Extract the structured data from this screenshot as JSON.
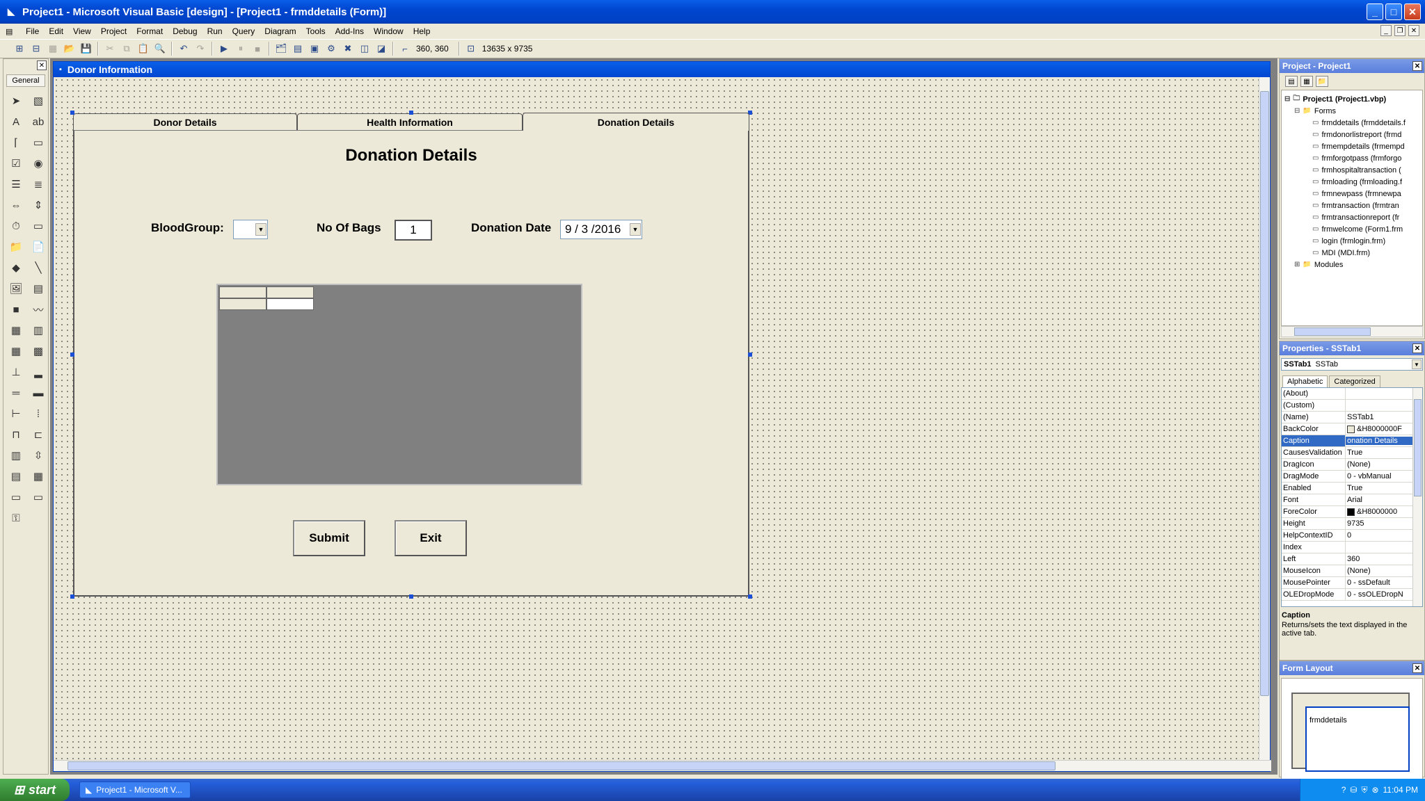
{
  "window": {
    "title": "Project1 - Microsoft Visual Basic [design] - [Project1 - frmddetails (Form)]"
  },
  "menu": [
    "File",
    "Edit",
    "View",
    "Project",
    "Format",
    "Debug",
    "Run",
    "Query",
    "Diagram",
    "Tools",
    "Add-Ins",
    "Window",
    "Help"
  ],
  "toolbar": {
    "position_readout": "360, 360",
    "size_readout": "13635 x 9735"
  },
  "toolbox": {
    "tab_label": "General"
  },
  "form": {
    "title": "Donor Information",
    "tabs": [
      "Donor Details",
      "Health Information",
      "Donation Details"
    ],
    "active_tab": "Donation Details",
    "heading": "Donation Details",
    "blood_group_label": "BloodGroup:",
    "blood_group_value": "",
    "bags_label": "No Of Bags",
    "bags_value": "1",
    "date_label": "Donation Date",
    "date_value": "9 / 3 /2016",
    "submit_label": "Submit",
    "exit_label": "Exit"
  },
  "project": {
    "panel_title": "Project - Project1",
    "root": "Project1 (Project1.vbp)",
    "forms_folder": "Forms",
    "forms": [
      "frmddetails (frmddetails.f",
      "frmdonorlistreport (frmd",
      "frmempdetails (frmempd",
      "frmforgotpass (frmforgo",
      "frmhospitaltransaction (",
      "frmloading (frmloading.f",
      "frmnewpass (frmnewpa",
      "frmtransaction (frmtran",
      "frmtransactionreport (fr",
      "frmwelcome (Form1.frm",
      "login (frmlogin.frm)",
      "MDI (MDI.frm)"
    ],
    "modules_folder": "Modules"
  },
  "properties": {
    "panel_title": "Properties - SSTab1",
    "object_name": "SSTab1",
    "object_type": "SSTab",
    "tab_alphabetic": "Alphabetic",
    "tab_categorized": "Categorized",
    "rows": [
      {
        "name": "(About)",
        "value": ""
      },
      {
        "name": "(Custom)",
        "value": ""
      },
      {
        "name": "(Name)",
        "value": "SSTab1"
      },
      {
        "name": "BackColor",
        "value": "&H8000000F",
        "swatch": "#ece9d8"
      },
      {
        "name": "Caption",
        "value": "onation Details",
        "selected": true
      },
      {
        "name": "CausesValidation",
        "value": "True"
      },
      {
        "name": "DragIcon",
        "value": "(None)"
      },
      {
        "name": "DragMode",
        "value": "0 - vbManual"
      },
      {
        "name": "Enabled",
        "value": "True"
      },
      {
        "name": "Font",
        "value": "Arial"
      },
      {
        "name": "ForeColor",
        "value": "&H8000000",
        "swatch": "#000000"
      },
      {
        "name": "Height",
        "value": "9735"
      },
      {
        "name": "HelpContextID",
        "value": "0"
      },
      {
        "name": "Index",
        "value": ""
      },
      {
        "name": "Left",
        "value": "360"
      },
      {
        "name": "MouseIcon",
        "value": "(None)"
      },
      {
        "name": "MousePointer",
        "value": "0 - ssDefault"
      },
      {
        "name": "OLEDropMode",
        "value": "0 - ssOLEDropN"
      }
    ],
    "desc_title": "Caption",
    "desc_text": "Returns/sets the text displayed in the active tab."
  },
  "form_layout": {
    "panel_title": "Form Layout",
    "form_name": "frmddetails"
  },
  "taskbar": {
    "start_label": "start",
    "task_label": "Project1 - Microsoft V...",
    "clock": "11:04 PM"
  }
}
